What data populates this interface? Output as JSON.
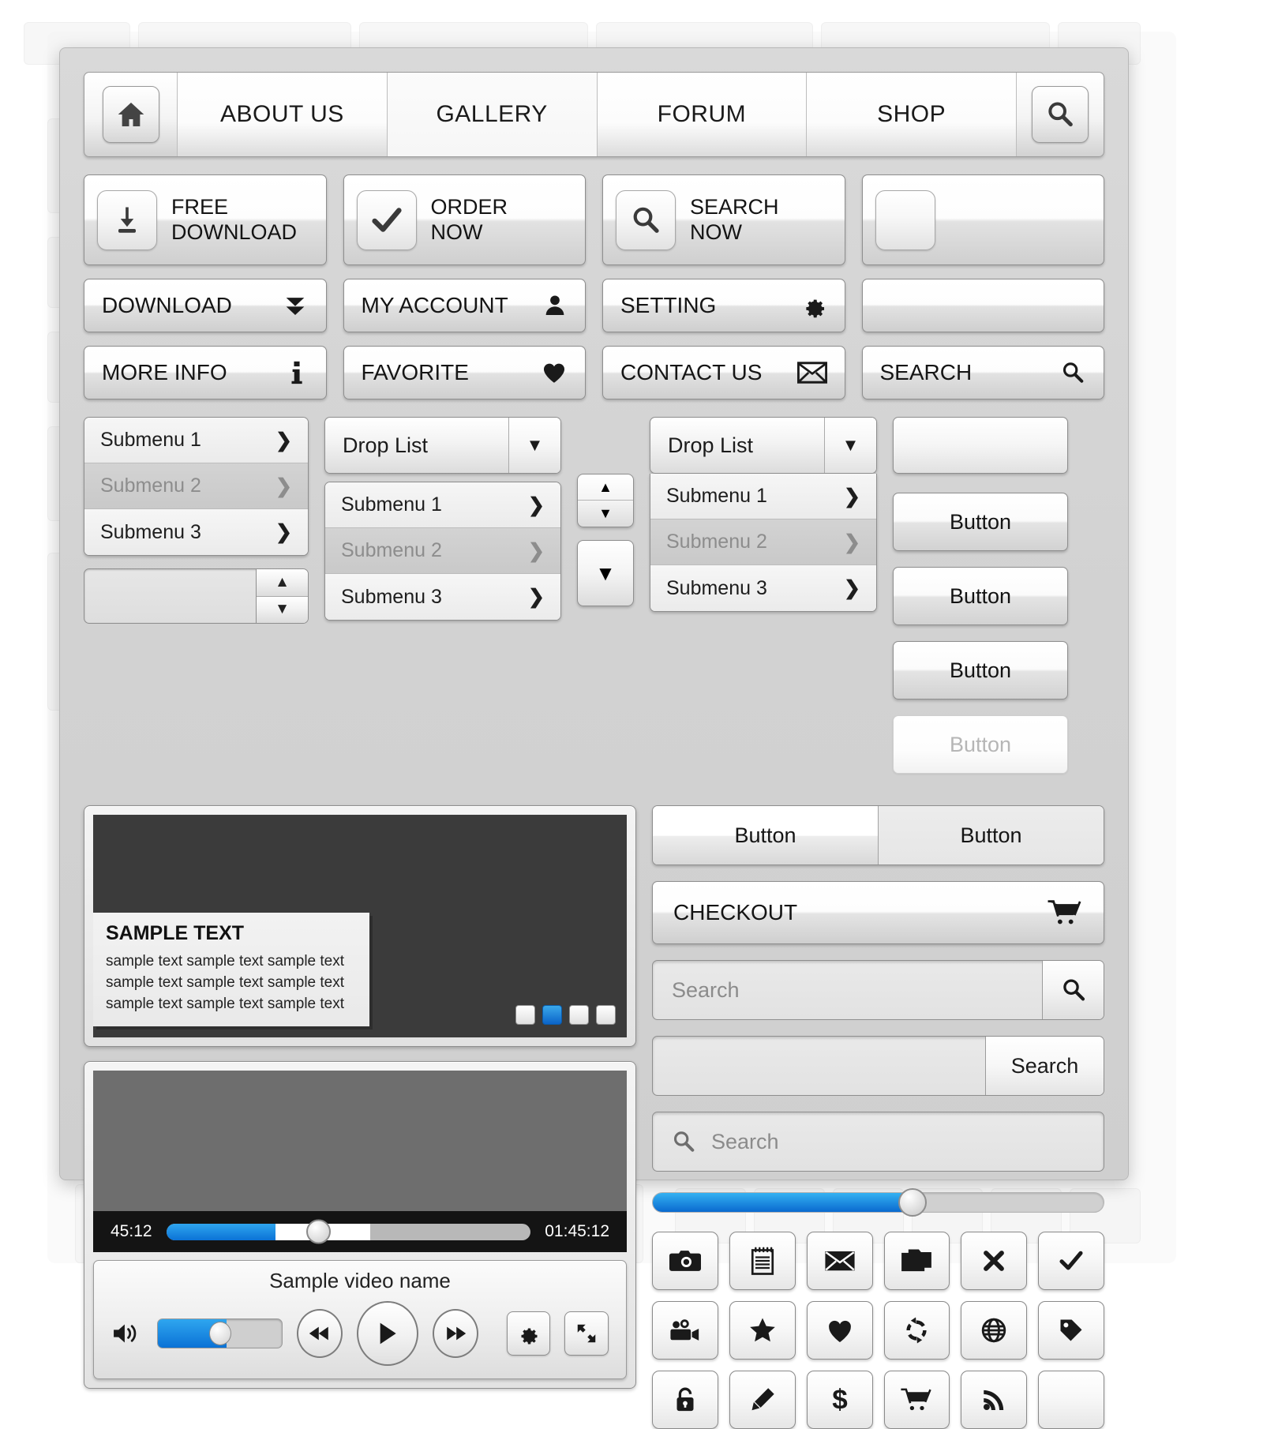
{
  "nav": {
    "home_icon": "home-icon",
    "items": [
      {
        "label": "ABOUT US",
        "active": false
      },
      {
        "label": "GALLERY",
        "active": true
      },
      {
        "label": "FORUM",
        "active": false
      },
      {
        "label": "SHOP",
        "active": false
      }
    ],
    "search_icon": "search-icon"
  },
  "big_buttons": [
    {
      "line1": "FREE",
      "line2": "DOWNLOAD",
      "icon": "download-icon"
    },
    {
      "line1": "ORDER",
      "line2": "NOW",
      "icon": "check-icon"
    },
    {
      "line1": "SEARCH",
      "line2": "NOW",
      "icon": "search-icon"
    },
    {
      "line1": "",
      "line2": "",
      "icon": "blank-icon"
    }
  ],
  "bar_buttons_row1": [
    {
      "label": "DOWNLOAD",
      "icon": "double-chevron-down-icon"
    },
    {
      "label": "MY ACCOUNT",
      "icon": "user-icon"
    },
    {
      "label": "SETTING",
      "icon": "gear-icon"
    },
    {
      "label": "",
      "icon": "blank-icon"
    }
  ],
  "bar_buttons_row2": [
    {
      "label": "MORE INFO",
      "icon": "info-icon"
    },
    {
      "label": "FAVORITE",
      "icon": "heart-icon"
    },
    {
      "label": "CONTACT US",
      "icon": "envelope-icon"
    },
    {
      "label": "SEARCH",
      "icon": "search-icon"
    }
  ],
  "submenu_list": [
    {
      "label": "Submenu 1",
      "dim": false
    },
    {
      "label": "Submenu 2",
      "dim": true
    },
    {
      "label": "Submenu 3",
      "dim": false
    }
  ],
  "spinner": {
    "value": ""
  },
  "droplist_b": {
    "label": "Drop List",
    "items": [
      {
        "label": "Submenu 1",
        "dim": false
      },
      {
        "label": "Submenu 2",
        "dim": true
      },
      {
        "label": "Submenu 3",
        "dim": false
      }
    ]
  },
  "droplist_c": {
    "label": "Drop List",
    "items": [
      {
        "label": "Submenu 1",
        "dim": false
      },
      {
        "label": "Submenu 2",
        "dim": true
      },
      {
        "label": "Submenu 3",
        "dim": false
      }
    ]
  },
  "side_buttons": [
    {
      "label": "Button",
      "disabled": false
    },
    {
      "label": "Button",
      "disabled": false
    },
    {
      "label": "Button",
      "disabled": false
    },
    {
      "label": "Button",
      "disabled": true
    }
  ],
  "slider_panel": {
    "caption_title": "SAMPLE TEXT",
    "caption_lines": [
      "sample text sample text sample text",
      "sample text sample text sample text",
      "sample text sample text sample text"
    ],
    "dots": [
      false,
      true,
      false,
      false
    ]
  },
  "video": {
    "current_time": "45:12",
    "total_time": "01:45:12",
    "title": "Sample video name",
    "progress_percent": 30,
    "buffer_percent": 56,
    "volume_percent": 55,
    "volume_icon": "speaker-icon",
    "prev_icon": "rewind-icon",
    "play_icon": "play-icon",
    "next_icon": "fast-forward-icon",
    "settings_icon": "gear-icon",
    "fullscreen_icon": "fullscreen-icon"
  },
  "segmented": {
    "left_label": "Button",
    "right_label": "Button"
  },
  "checkout": {
    "label": "CHECKOUT",
    "icon": "cart-icon"
  },
  "search_widgets": {
    "plain_placeholder": "Search",
    "plain_icon": "search-icon",
    "button_label": "Search",
    "button_field_value": "",
    "lead_placeholder": "Search",
    "lead_icon": "search-icon"
  },
  "range_slider": {
    "percent": 56,
    "accent": "#0a69cf"
  },
  "icon_grid": [
    "camera-icon",
    "notepad-icon",
    "envelope-icon",
    "folder-icon",
    "close-icon",
    "check-icon",
    "video-camera-icon",
    "star-icon",
    "heart-icon",
    "refresh-icon",
    "globe-icon",
    "tag-icon",
    "lock-icon",
    "pencil-icon",
    "dollar-icon",
    "cart-icon",
    "rss-icon",
    "blank-icon"
  ],
  "colors": {
    "accent": "#0a69cf",
    "accent_light": "#34b1f2",
    "surface": "#d2d2d2"
  }
}
